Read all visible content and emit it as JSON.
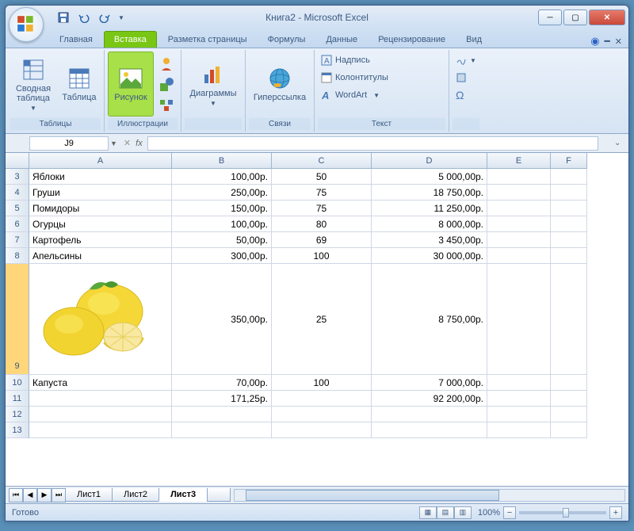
{
  "title": "Книга2 - Microsoft Excel",
  "tabs": {
    "t0": "Главная",
    "t1": "Вставка",
    "t2": "Разметка страницы",
    "t3": "Формулы",
    "t4": "Данные",
    "t5": "Рецензирование",
    "t6": "Вид"
  },
  "ribbon": {
    "g_tables": "Таблицы",
    "pivot": "Сводная таблица",
    "table": "Таблица",
    "g_illus": "Иллюстрации",
    "picture": "Рисунок",
    "charts": "Диаграммы",
    "g_links": "Связи",
    "hyperlink": "Гиперссылка",
    "g_text": "Текст",
    "textbox": "Надпись",
    "headerfooter": "Колонтитулы",
    "wordart": "WordArt"
  },
  "namebox": "J9",
  "fx_label": "fx",
  "cols": {
    "A": "A",
    "B": "B",
    "C": "C",
    "D": "D",
    "E": "E",
    "F": "F"
  },
  "rows": {
    "3": {
      "n": "3",
      "A": "Яблоки",
      "B": "100,00р.",
      "C": "50",
      "D": "5 000,00р."
    },
    "4": {
      "n": "4",
      "A": "Груши",
      "B": "250,00р.",
      "C": "75",
      "D": "18 750,00р."
    },
    "5": {
      "n": "5",
      "A": "Помидоры",
      "B": "150,00р.",
      "C": "75",
      "D": "11 250,00р."
    },
    "6": {
      "n": "6",
      "A": "Огурцы",
      "B": "100,00р.",
      "C": "80",
      "D": "8 000,00р."
    },
    "7": {
      "n": "7",
      "A": "Картофель",
      "B": "50,00р.",
      "C": "69",
      "D": "3 450,00р."
    },
    "8": {
      "n": "8",
      "A": "Апельсины",
      "B": "300,00р.",
      "C": "100",
      "D": "30 000,00р."
    },
    "9": {
      "n": "9",
      "B": "350,00р.",
      "C": "25",
      "D": "8 750,00р."
    },
    "10": {
      "n": "10",
      "A": "Капуста",
      "B": "70,00р.",
      "C": "100",
      "D": "7 000,00р."
    },
    "11": {
      "n": "11",
      "B": "171,25р.",
      "D": "92 200,00р."
    },
    "12": {
      "n": "12"
    },
    "13": {
      "n": "13"
    }
  },
  "sheets": {
    "s1": "Лист1",
    "s2": "Лист2",
    "s3": "Лист3"
  },
  "status": "Готово",
  "zoom": "100%"
}
